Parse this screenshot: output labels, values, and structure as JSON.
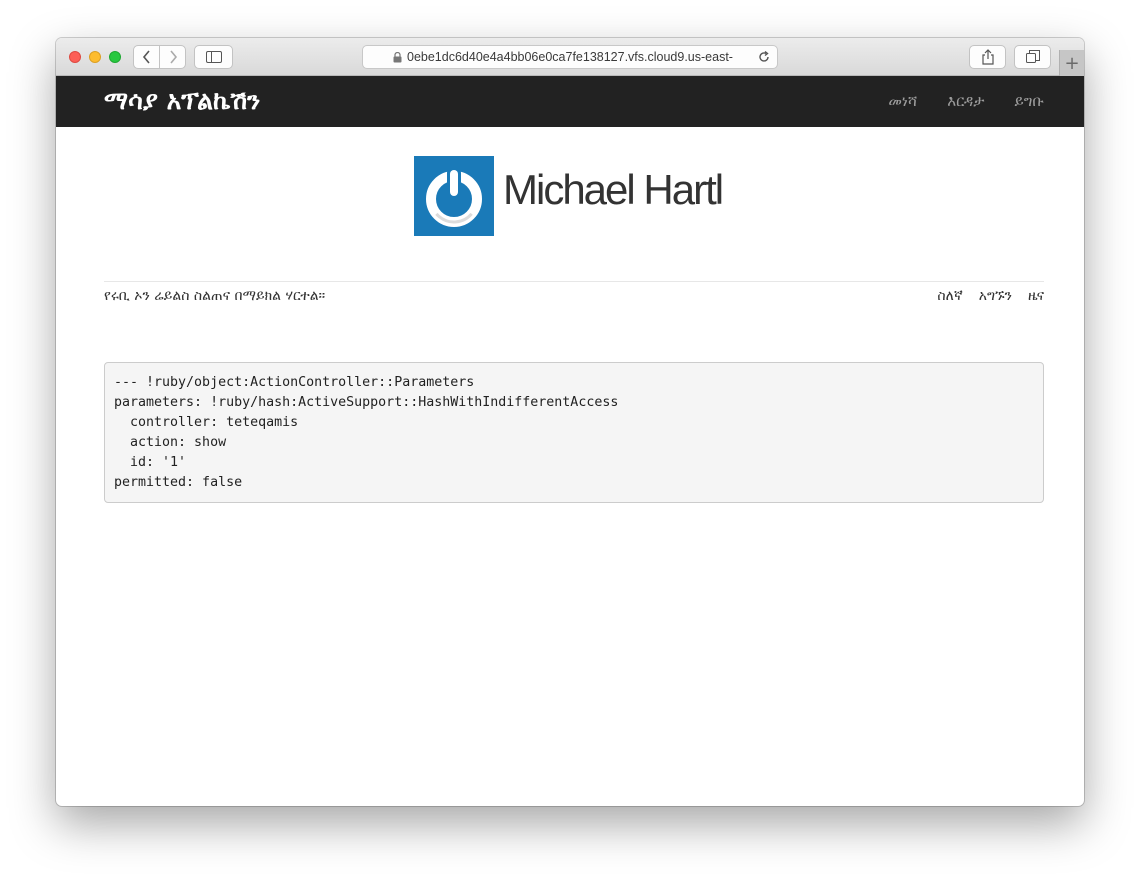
{
  "browser": {
    "url": "0ebe1dc6d40e4a4bb06e0ca7fe138127.vfs.cloud9.us-east-"
  },
  "navbar": {
    "brand": "ማሳያ አፕልኬሽን",
    "links": [
      "መነሻ",
      "እርዳታ",
      "ይግቡ"
    ]
  },
  "header": {
    "logo_name": "Michael Hartl"
  },
  "footer_bar": {
    "tagline": "የሩቢ ኦን ሬይልስ ስልጠና በማይክል ሃርተል።",
    "links": [
      "ስለኛ",
      "አግኙን",
      "ዜና"
    ]
  },
  "debug": {
    "lines": [
      "--- !ruby/object:ActionController::Parameters",
      "parameters: !ruby/hash:ActiveSupport::HashWithIndifferentAccess",
      "  controller: teteqamis",
      "  action: show",
      "  id: '1'",
      "permitted: false"
    ]
  },
  "colors": {
    "navbar_bg": "#222222",
    "logo_bg": "#1a7ab8"
  }
}
